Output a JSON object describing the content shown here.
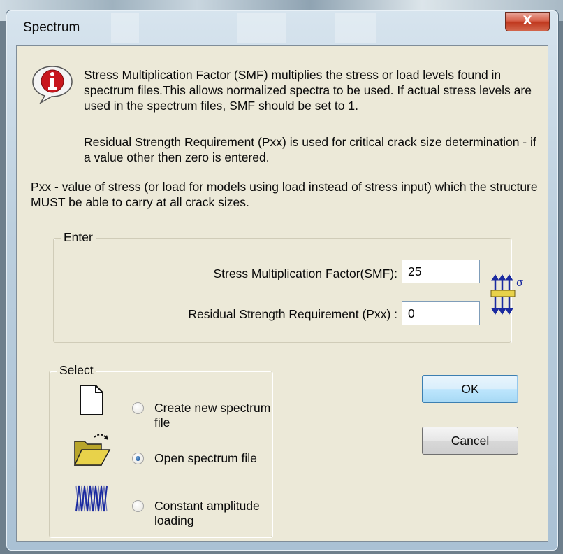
{
  "window": {
    "title": "Spectrum",
    "close_label": "X"
  },
  "info": {
    "paragraph1": "Stress Multiplication Factor (SMF) multiplies the stress or load levels found in spectrum files.This allows normalized spectra to be used. If actual stress levels are used in the spectrum files, SMF should be set to 1.",
    "paragraph2": "Residual Strength Requirement (Pxx) is used for critical crack size determination - if a value other then zero is entered.",
    "paragraph3": "Pxx - value of stress (or load for models using load instead of stress input) which the structure MUST be able to carry at all crack sizes."
  },
  "enter_group": {
    "label": "Enter",
    "smf_label": "Stress Multiplication Factor(SMF):",
    "smf_value": "25",
    "pxx_label": "Residual Strength Requirement (Pxx) :",
    "pxx_value": "0",
    "sigma_symbol": "σ"
  },
  "select_group": {
    "label": "Select",
    "options": [
      {
        "label": "Create new spectrum file",
        "icon": "new-file-icon",
        "checked": false
      },
      {
        "label": "Open spectrum file",
        "icon": "open-folder-icon",
        "checked": true
      },
      {
        "label": "Constant amplitude loading",
        "icon": "constant-amplitude-icon",
        "checked": false
      }
    ]
  },
  "buttons": {
    "ok": "OK",
    "cancel": "Cancel"
  },
  "colors": {
    "dialog_face": "#ece9d8",
    "close_button": "#c0391f",
    "radio_checked": "#1f5aa0",
    "icon_blue": "#1a2aa0",
    "folder_yellow": "#e8d24a"
  }
}
